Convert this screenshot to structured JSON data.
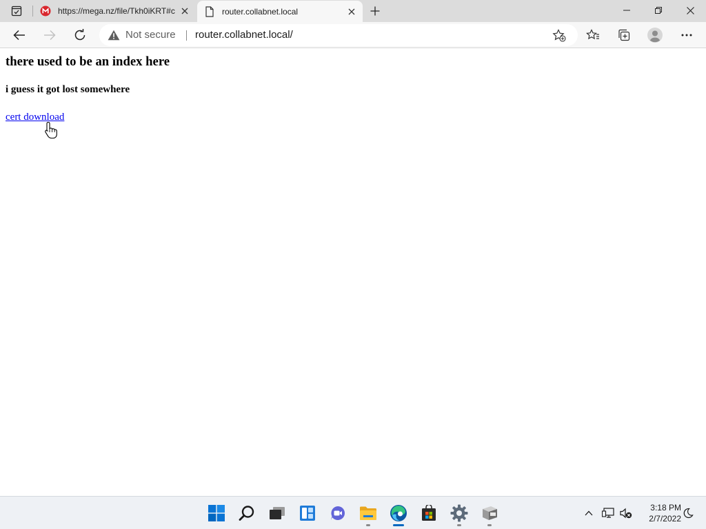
{
  "browser": {
    "tabs": [
      {
        "title": "https://mega.nz/file/Tkh0iKRT#c",
        "favicon": "mega-icon",
        "active": false
      },
      {
        "title": "router.collabnet.local",
        "favicon": "page-icon",
        "active": true
      }
    ],
    "address_bar": {
      "security_label": "Not secure",
      "url": "router.collabnet.local/"
    }
  },
  "page": {
    "heading": "there used to be an index here",
    "subheading": "i guess it got lost somewhere",
    "link_text": "cert download"
  },
  "taskbar": {
    "apps": [
      "start-icon",
      "search-icon",
      "task-view-icon",
      "widgets-icon",
      "chat-icon",
      "file-explorer-icon",
      "edge-icon",
      "store-icon",
      "settings-icon",
      "app-icon"
    ],
    "clock": {
      "time": "3:18 PM",
      "date": "2/7/2022"
    }
  },
  "colors": {
    "link": "#0000ee",
    "mega_red": "#d9272e",
    "edge_blue": "#0c59a4",
    "start_blue": "#0067c0"
  }
}
